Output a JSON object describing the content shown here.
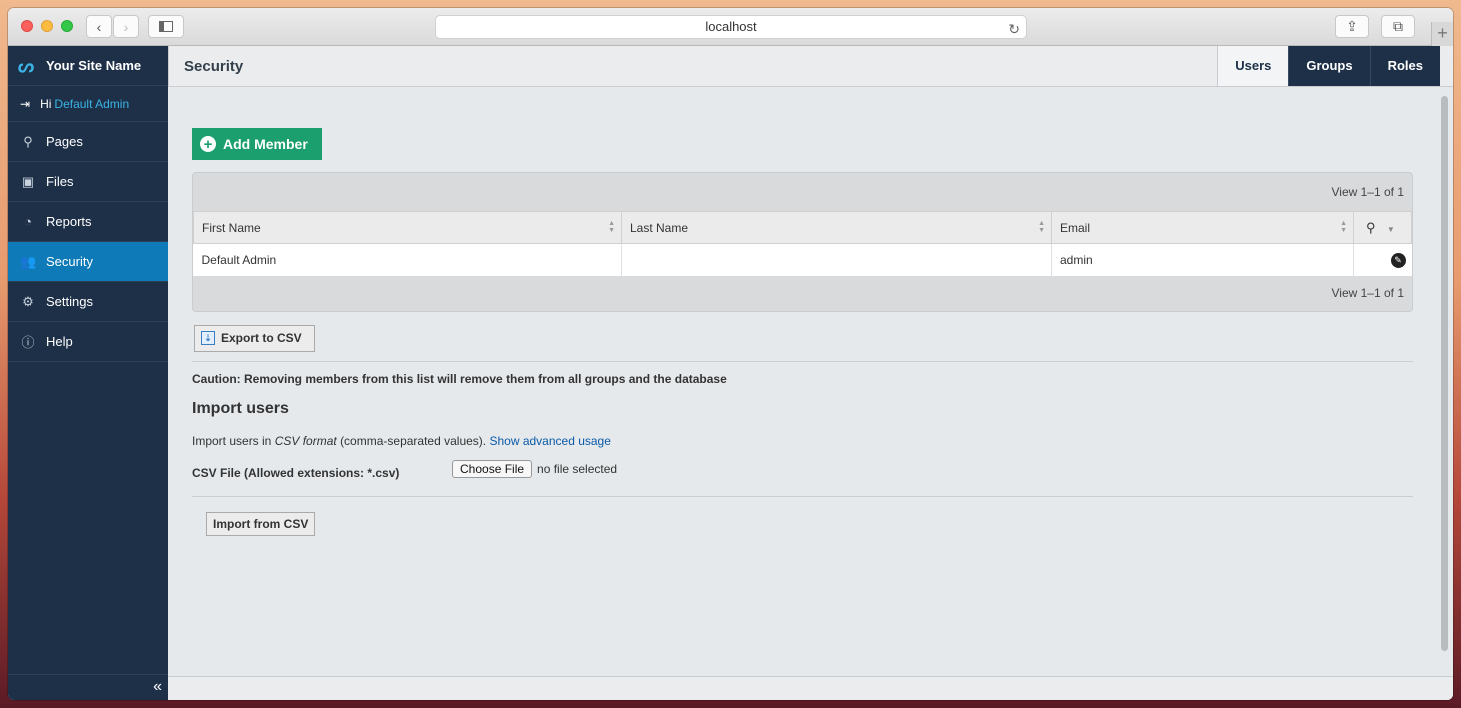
{
  "browser": {
    "url": "localhost",
    "back_icon": "chevron-left-icon",
    "forward_icon": "chevron-right-icon"
  },
  "sidebar": {
    "site_name": "Your Site Name",
    "greeting": "Hi",
    "user_name": "Default Admin",
    "items": [
      {
        "label": "Pages",
        "icon": "sitemap-icon"
      },
      {
        "label": "Files",
        "icon": "image-icon"
      },
      {
        "label": "Reports",
        "icon": "pie-chart-icon"
      },
      {
        "label": "Security",
        "icon": "users-icon"
      },
      {
        "label": "Settings",
        "icon": "gears-icon"
      },
      {
        "label": "Help",
        "icon": "info-icon"
      }
    ],
    "collapse_label": "«"
  },
  "header": {
    "title": "Security",
    "tabs": [
      "Users",
      "Groups",
      "Roles"
    ]
  },
  "main": {
    "add_member_label": "Add Member",
    "pager_top": "View 1–1 of 1",
    "pager_bottom": "View 1–1 of 1",
    "columns": [
      "First Name",
      "Last Name",
      "Email"
    ],
    "rows": [
      {
        "first_name": "Default Admin",
        "last_name": "",
        "email": "admin"
      }
    ],
    "export_label": "Export to CSV",
    "caution": "Caution: Removing members from this list will remove them from all groups and the database",
    "import_title": "Import users",
    "import_desc_prefix": "Import users in",
    "import_desc_format": "CSV format",
    "import_desc_suffix": "(comma-separated values).",
    "advanced_link": "Show advanced usage",
    "csv_label": "CSV File (Allowed extensions: *.csv)",
    "choose_file": "Choose File",
    "no_file": "no file selected",
    "import_button": "Import from CSV"
  },
  "colors": {
    "sidebar_bg": "#1d3048",
    "active_nav": "#0e7ab8",
    "add_button": "#1b9f6e",
    "link": "#0b5aa8"
  }
}
